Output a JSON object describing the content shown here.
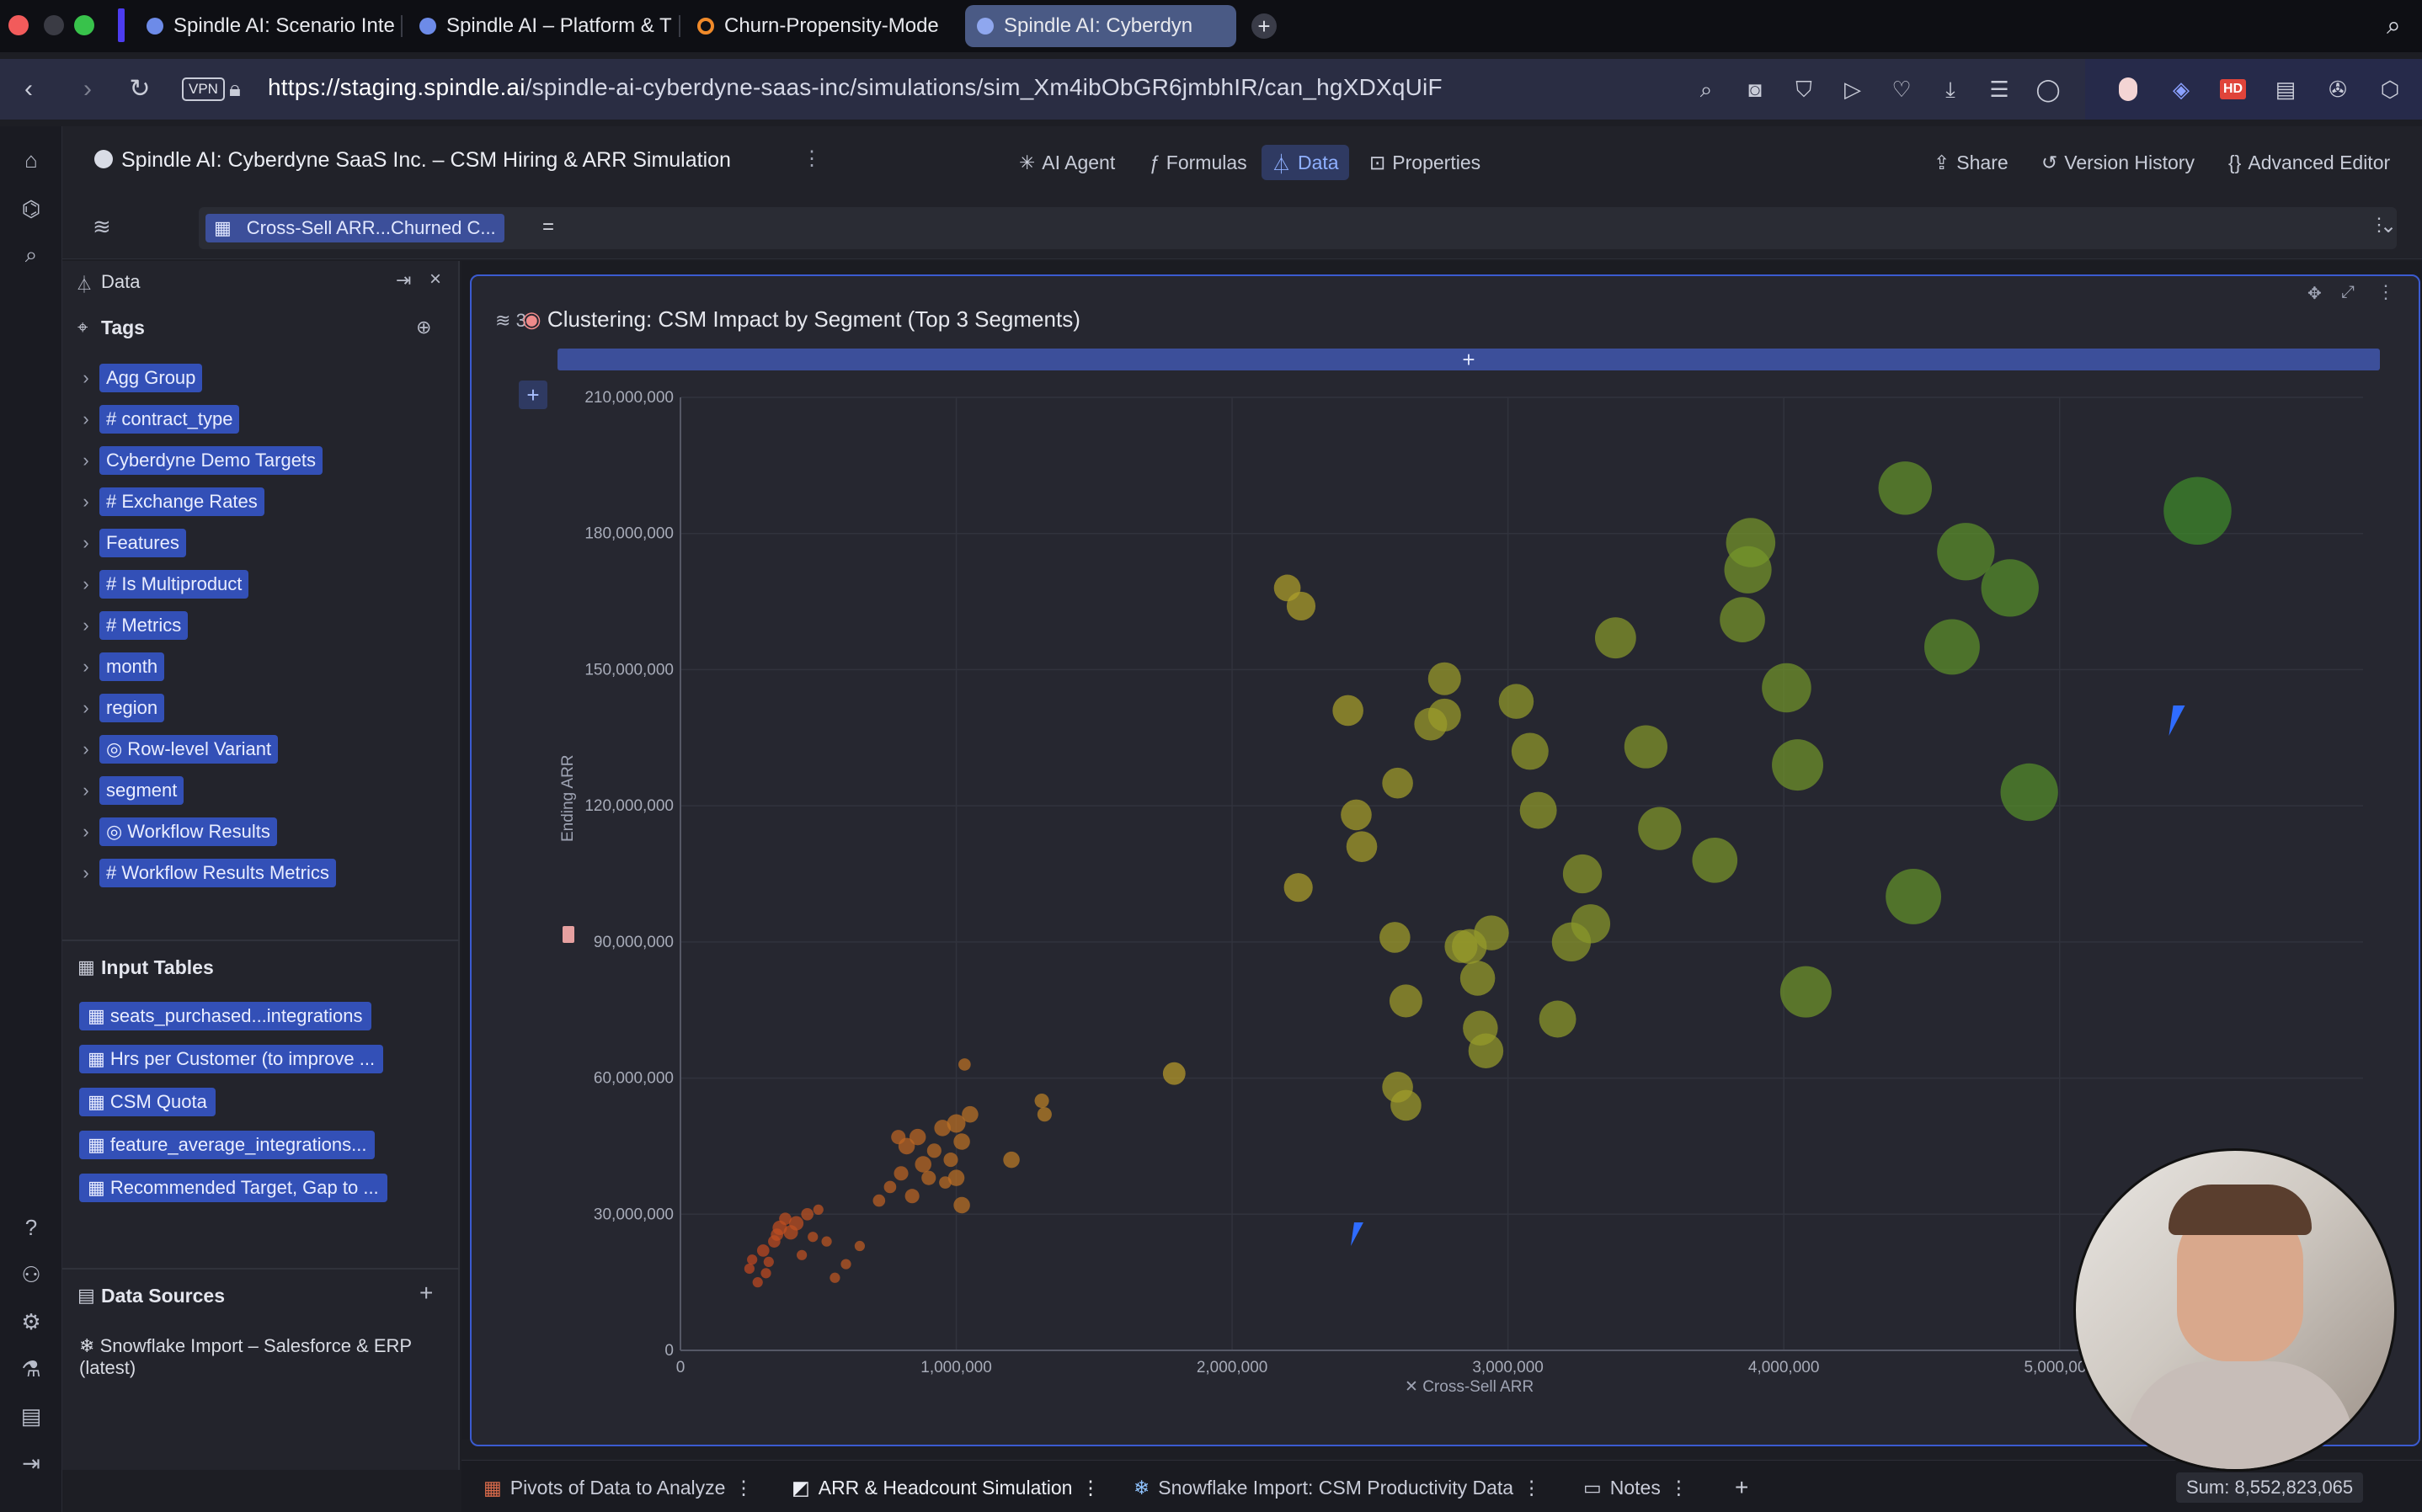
{
  "browser": {
    "tabs": [
      {
        "label": "Spindle AI: Scenario Inte",
        "active": false
      },
      {
        "label": "Spindle AI – Platform & T",
        "active": false
      },
      {
        "label": "Churn-Propensity-Mode",
        "active": false
      },
      {
        "label": "Spindle AI: Cyberdyn",
        "active": true
      }
    ],
    "url_host": "https://staging.spindle.ai",
    "url_path": "/spindle-ai-cyberdyne-saas-inc/simulations/sim_Xm4ibObGR6jmbhIR/can_hgXDXqUiF",
    "vpn_label": "VPN",
    "hd_badge": "HD"
  },
  "app": {
    "doc_title": "Spindle AI: Cyberdyne SaaS Inc. – CSM Hiring & ARR Simulation",
    "toolbar": {
      "ai_agent": "AI Agent",
      "formulas": "Formulas",
      "data": "Data",
      "properties": "Properties"
    },
    "right_actions": {
      "share": "Share",
      "version_history": "Version History",
      "advanced_editor": "Advanced Editor"
    },
    "formula": {
      "chip": "Cross-Sell ARR...Churned C...",
      "operator": "="
    }
  },
  "sidebar": {
    "panel_title": "Data",
    "tags_title": "Tags",
    "tags": [
      {
        "label": "Agg Group",
        "prefix": ""
      },
      {
        "label": "contract_type",
        "prefix": "#"
      },
      {
        "label": "Cyberdyne Demo Targets",
        "prefix": ""
      },
      {
        "label": "Exchange Rates",
        "prefix": "#"
      },
      {
        "label": "Features",
        "prefix": ""
      },
      {
        "label": "Is Multiproduct",
        "prefix": "#"
      },
      {
        "label": "Metrics",
        "prefix": "#"
      },
      {
        "label": "month",
        "prefix": ""
      },
      {
        "label": "region",
        "prefix": ""
      },
      {
        "label": "Row-level Variant",
        "prefix": "◎"
      },
      {
        "label": "segment",
        "prefix": ""
      },
      {
        "label": "Workflow Results",
        "prefix": "◎"
      },
      {
        "label": "Workflow Results Metrics",
        "prefix": "#"
      }
    ],
    "input_tables_title": "Input Tables",
    "input_tables": [
      "seats_purchased...integrations",
      "Hrs per Customer (to improve ...",
      "CSM Quota",
      "feature_average_integrations...",
      "Recommended Target, Gap to ..."
    ],
    "data_sources_title": "Data Sources",
    "data_sources": [
      "Snowflake Import – Salesforce & ERP (latest)"
    ]
  },
  "card": {
    "badge_count": "3",
    "title": "Clustering: CSM Impact by Segment (Top 3 Segments)",
    "plus": "+"
  },
  "chart_data": {
    "type": "scatter",
    "title": "Clustering: CSM Impact by Segment (Top 3 Segments)",
    "xlabel": "Cross-Sell ARR",
    "ylabel": "Ending ARR",
    "xlim": [
      0,
      6100000
    ],
    "ylim": [
      0,
      210000000
    ],
    "x_ticks": [
      "0",
      "1,000,000",
      "2,000,000",
      "3,000,000",
      "4,000,000",
      "5,000,000"
    ],
    "y_ticks": [
      "0",
      "30,000,000",
      "60,000,000",
      "90,000,000",
      "120,000,000",
      "150,000,000",
      "180,000,000",
      "210,000,000"
    ],
    "grid": true,
    "colors": {
      "low": "#c23a1e",
      "mid": "#b8a22a",
      "high": "#3f8a2a"
    },
    "points": [
      [
        250000,
        18000000,
        5
      ],
      [
        280000,
        15000000,
        5
      ],
      [
        300000,
        22000000,
        6
      ],
      [
        320000,
        19500000,
        5
      ],
      [
        340000,
        24000000,
        6
      ],
      [
        360000,
        27000000,
        7
      ],
      [
        380000,
        29000000,
        6
      ],
      [
        400000,
        26000000,
        7
      ],
      [
        420000,
        28000000,
        7
      ],
      [
        440000,
        21000000,
        5
      ],
      [
        460000,
        30000000,
        6
      ],
      [
        480000,
        25000000,
        5
      ],
      [
        500000,
        31000000,
        5
      ],
      [
        530000,
        24000000,
        5
      ],
      [
        560000,
        16000000,
        5
      ],
      [
        600000,
        19000000,
        5
      ],
      [
        650000,
        23000000,
        5
      ],
      [
        260000,
        20000000,
        5
      ],
      [
        310000,
        17000000,
        5
      ],
      [
        350000,
        25500000,
        6
      ],
      [
        720000,
        33000000,
        6
      ],
      [
        760000,
        36000000,
        6
      ],
      [
        800000,
        39000000,
        7
      ],
      [
        820000,
        45000000,
        8
      ],
      [
        840000,
        34000000,
        7
      ],
      [
        860000,
        47000000,
        8
      ],
      [
        880000,
        41000000,
        8
      ],
      [
        900000,
        38000000,
        7
      ],
      [
        920000,
        44000000,
        7
      ],
      [
        950000,
        49000000,
        8
      ],
      [
        980000,
        42000000,
        7
      ],
      [
        1000000,
        50000000,
        9
      ],
      [
        1020000,
        46000000,
        8
      ],
      [
        1050000,
        52000000,
        8
      ],
      [
        1000000,
        38000000,
        8
      ],
      [
        1020000,
        32000000,
        8
      ],
      [
        960000,
        37000000,
        6
      ],
      [
        790000,
        47000000,
        7
      ],
      [
        1200000,
        42000000,
        8
      ],
      [
        1030000,
        63000000,
        6
      ],
      [
        1310000,
        55000000,
        7
      ],
      [
        1320000,
        52000000,
        7
      ],
      [
        1790000,
        61000000,
        11
      ],
      [
        2200000,
        168000000,
        13
      ],
      [
        2250000,
        164000000,
        14
      ],
      [
        2240000,
        102000000,
        14
      ],
      [
        2420000,
        141000000,
        15
      ],
      [
        2450000,
        118000000,
        15
      ],
      [
        2470000,
        111000000,
        15
      ],
      [
        2600000,
        125000000,
        15
      ],
      [
        2590000,
        91000000,
        15
      ],
      [
        2630000,
        77000000,
        16
      ],
      [
        2720000,
        138000000,
        16
      ],
      [
        2770000,
        140000000,
        16
      ],
      [
        2770000,
        148000000,
        16
      ],
      [
        2830000,
        89000000,
        16
      ],
      [
        2860000,
        89000000,
        17
      ],
      [
        2890000,
        82000000,
        17
      ],
      [
        2900000,
        71000000,
        17
      ],
      [
        2920000,
        66000000,
        17
      ],
      [
        2940000,
        92000000,
        17
      ],
      [
        3030000,
        143000000,
        17
      ],
      [
        3080000,
        132000000,
        18
      ],
      [
        3110000,
        119000000,
        18
      ],
      [
        3180000,
        73000000,
        18
      ],
      [
        3230000,
        90000000,
        19
      ],
      [
        3270000,
        105000000,
        19
      ],
      [
        3300000,
        94000000,
        19
      ],
      [
        2600000,
        58000000,
        15
      ],
      [
        2630000,
        54000000,
        15
      ],
      [
        3390000,
        157000000,
        20
      ],
      [
        3500000,
        133000000,
        21
      ],
      [
        3550000,
        115000000,
        21
      ],
      [
        3750000,
        108000000,
        22
      ],
      [
        3850000,
        161000000,
        22
      ],
      [
        3870000,
        172000000,
        23
      ],
      [
        3880000,
        178000000,
        24
      ],
      [
        4010000,
        146000000,
        24
      ],
      [
        4050000,
        129000000,
        25
      ],
      [
        4080000,
        79000000,
        25
      ],
      [
        4440000,
        190000000,
        26
      ],
      [
        4610000,
        155000000,
        27
      ],
      [
        4470000,
        100000000,
        27
      ],
      [
        4660000,
        176000000,
        28
      ],
      [
        4820000,
        168000000,
        28
      ],
      [
        4890000,
        123000000,
        28
      ],
      [
        5500000,
        185000000,
        33
      ]
    ]
  },
  "bottom_sheets": [
    "Pivots of Data to Analyze",
    "ARR & Headcount Simulation",
    "Snowflake Import: CSM Productivity Data",
    "Notes"
  ],
  "status": {
    "sum_label": "Sum: 8,552,823,065"
  }
}
